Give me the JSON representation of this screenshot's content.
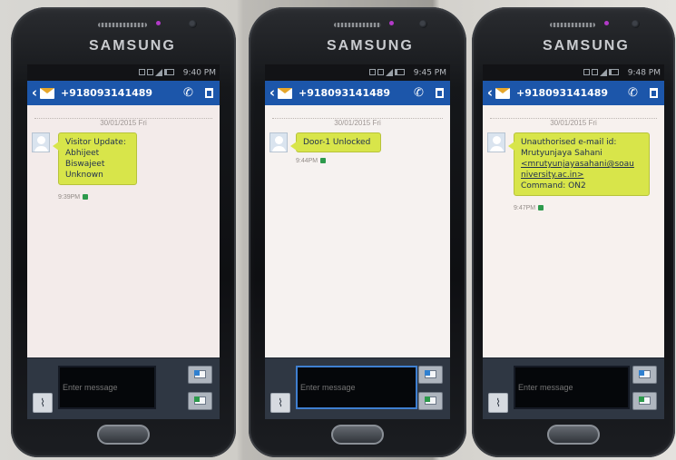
{
  "phones": [
    {
      "brand": "SAMSUNG",
      "status_time": "9:40 PM",
      "contact_number": "+918093141489",
      "date": "30/01/2015 Fri",
      "message_lines": [
        "Visitor Update:",
        "Abhijeet",
        "Biswajeet",
        "Unknown"
      ],
      "timestamp": "9:39PM",
      "compose_placeholder": "Enter message"
    },
    {
      "brand": "SAMSUNG",
      "status_time": "9:45 PM",
      "contact_number": "+918093141489",
      "date": "30/01/2015 Fri",
      "message_lines": [
        "Door-1 Unlocked"
      ],
      "timestamp": "9:44PM",
      "compose_placeholder": "Enter message"
    },
    {
      "brand": "SAMSUNG",
      "status_time": "9:48 PM",
      "contact_number": "+918093141489",
      "date": "30/01/2015 Fri",
      "message_lines": [
        "Unauthorised e-mail id:",
        "Mrutyunjaya Sahani",
        "<mrutyunjayasahani@soau",
        "niversity.ac.in>",
        "Command: ON2"
      ],
      "timestamp": "9:47PM",
      "compose_placeholder": "Enter message"
    }
  ],
  "icons": {
    "back": "back-arrow-icon",
    "conversation": "envelope-icon",
    "call": "phone-icon",
    "delete": "trash-icon",
    "attach": "paperclip-icon",
    "send": "send-message-icon"
  },
  "colors": {
    "header_blue": "#1c56aa",
    "bubble_green": "#d8e54a",
    "compose_dark": "#2f3743"
  }
}
